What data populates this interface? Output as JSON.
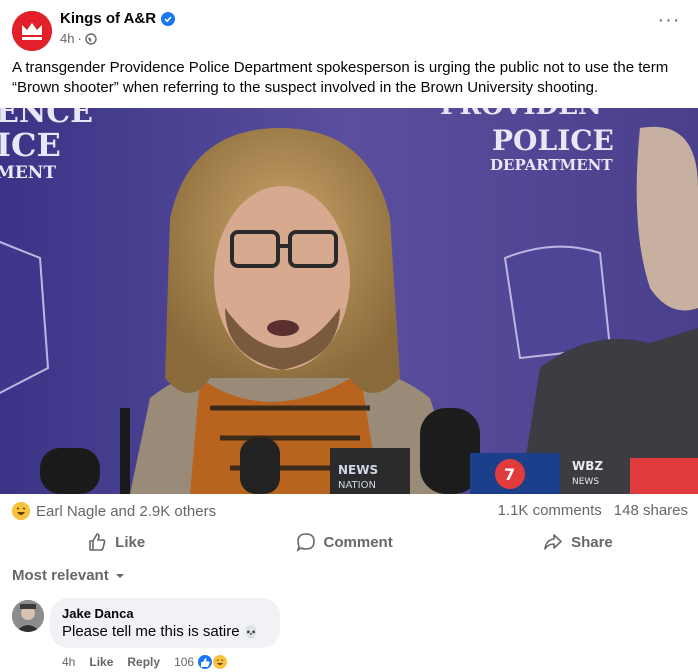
{
  "post": {
    "author": "Kings of A&R",
    "time": "4h",
    "separator": "·",
    "more_label": "···",
    "text": "A transgender Providence Police Department spokesperson is urging the public not to use the term “Brown shooter” when referring to the suspect involved in the Brown University shooting."
  },
  "media": {
    "backdrop_left": [
      "ENCE",
      "ICE",
      "MENT"
    ],
    "backdrop_right": [
      "PROVIDEN",
      "POLICE",
      "DEPARTMENT"
    ],
    "seal_text": "DEPARTMENT",
    "seal_top": "NCE",
    "seal_right": "PROVIDEN",
    "mic_labels": [
      "NEWS",
      "NATION",
      "WBZ",
      "NEWS"
    ],
    "mic_number": "7"
  },
  "stats": {
    "reactors": "Earl Nagle and 2.9K others",
    "comments": "1.1K comments",
    "shares": "148 shares"
  },
  "actions": {
    "like": "Like",
    "comment": "Comment",
    "share": "Share"
  },
  "sort": {
    "label": "Most relevant"
  },
  "comment": {
    "name": "Jake Danca",
    "text": "Please tell me this is satire",
    "emoji": "💀",
    "time": "4h",
    "like": "Like",
    "reply": "Reply",
    "reaction_count": "106"
  },
  "colors": {
    "brand": "#e3202a",
    "verified": "#1877f2",
    "backdrop": "#4a3f8c",
    "muted_text": "#65676b"
  }
}
